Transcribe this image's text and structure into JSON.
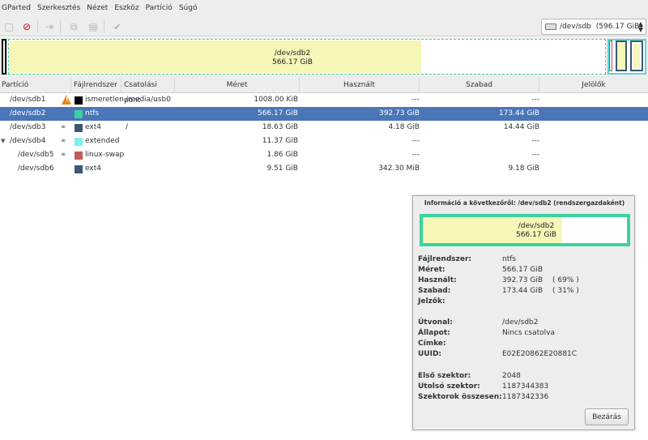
{
  "menu": [
    "GParted",
    "Szerkesztés",
    "Nézet",
    "Eszköz",
    "Partíció",
    "Súgó"
  ],
  "device": {
    "name": "/dev/sdb",
    "size": "(596.17 GiB)"
  },
  "diskmap": {
    "selected_name": "/dev/sdb2",
    "selected_size": "566.17 GiB"
  },
  "columns": [
    "Partíció",
    "Fájlrendszer",
    "Csatolási pont",
    "Méret",
    "Használt",
    "Szabad",
    "Jelölők"
  ],
  "rows": [
    {
      "partition": "/dev/sdb1",
      "fs": "ismeretlen",
      "mount": "/media/usb0",
      "size": "1008.00 KiB",
      "used": "---",
      "free": "---",
      "flags": "",
      "color": "#000000",
      "icon": "warning-icon",
      "indent": false,
      "expander": false,
      "selected": false
    },
    {
      "partition": "/dev/sdb2",
      "fs": "ntfs",
      "mount": "",
      "size": "566.17 GiB",
      "used": "392.73 GiB",
      "free": "173.44 GiB",
      "flags": "",
      "color": "#3ad3a0",
      "icon": "",
      "indent": false,
      "expander": false,
      "selected": true
    },
    {
      "partition": "/dev/sdb3",
      "fs": "ext4",
      "mount": "/",
      "size": "18.63 GiB",
      "used": "4.18 GiB",
      "free": "14.44 GiB",
      "flags": "",
      "color": "#3b5777",
      "icon": "key-icon",
      "indent": false,
      "expander": false,
      "selected": false
    },
    {
      "partition": "/dev/sdb4",
      "fs": "extended",
      "mount": "",
      "size": "11.37 GiB",
      "used": "---",
      "free": "---",
      "flags": "",
      "color": "#7ef0f0",
      "icon": "key-icon",
      "indent": false,
      "expander": true,
      "selected": false
    },
    {
      "partition": "/dev/sdb5",
      "fs": "linux-swap",
      "mount": "",
      "size": "1.86 GiB",
      "used": "---",
      "free": "---",
      "flags": "",
      "color": "#c05a5a",
      "icon": "key-icon",
      "indent": true,
      "expander": false,
      "selected": false
    },
    {
      "partition": "/dev/sdb6",
      "fs": "ext4",
      "mount": "",
      "size": "9.51 GiB",
      "used": "342.30 MiB",
      "free": "9.18 GiB",
      "flags": "",
      "color": "#3b5777",
      "icon": "",
      "indent": true,
      "expander": false,
      "selected": false
    }
  ],
  "dialog": {
    "title": "Információ a következőről: /dev/sdb2 (rendszergazdaként)",
    "map_name": "/dev/sdb2",
    "map_size": "566.17 GiB",
    "fields": [
      {
        "k": "Fájlrendszer:",
        "v": "ntfs",
        "p": ""
      },
      {
        "k": "Méret:",
        "v": "566.17 GiB",
        "p": ""
      },
      {
        "k": "Használt:",
        "v": "392.73 GiB",
        "p": "( 69% )"
      },
      {
        "k": "Szabad:",
        "v": "173.44 GiB",
        "p": "( 31% )"
      },
      {
        "k": "Jelzők:",
        "v": "",
        "p": ""
      }
    ],
    "fields2": [
      {
        "k": "Útvonal:",
        "v": "/dev/sdb2"
      },
      {
        "k": "Állapot:",
        "v": "Nincs csatolva"
      },
      {
        "k": "Címke:",
        "v": ""
      },
      {
        "k": "UUID:",
        "v": "E02E20862E20881C"
      }
    ],
    "fields3": [
      {
        "k": "Első szektor:",
        "v": "2048"
      },
      {
        "k": "Utolsó szektor:",
        "v": "1187344383"
      },
      {
        "k": "Szektorok összesen:",
        "v": "1187342336"
      }
    ],
    "close_label": "Bezárás"
  },
  "colors": {
    "selection": "#4a76b8",
    "ntfs": "#3ad3a0",
    "used": "#f6f6b8"
  }
}
